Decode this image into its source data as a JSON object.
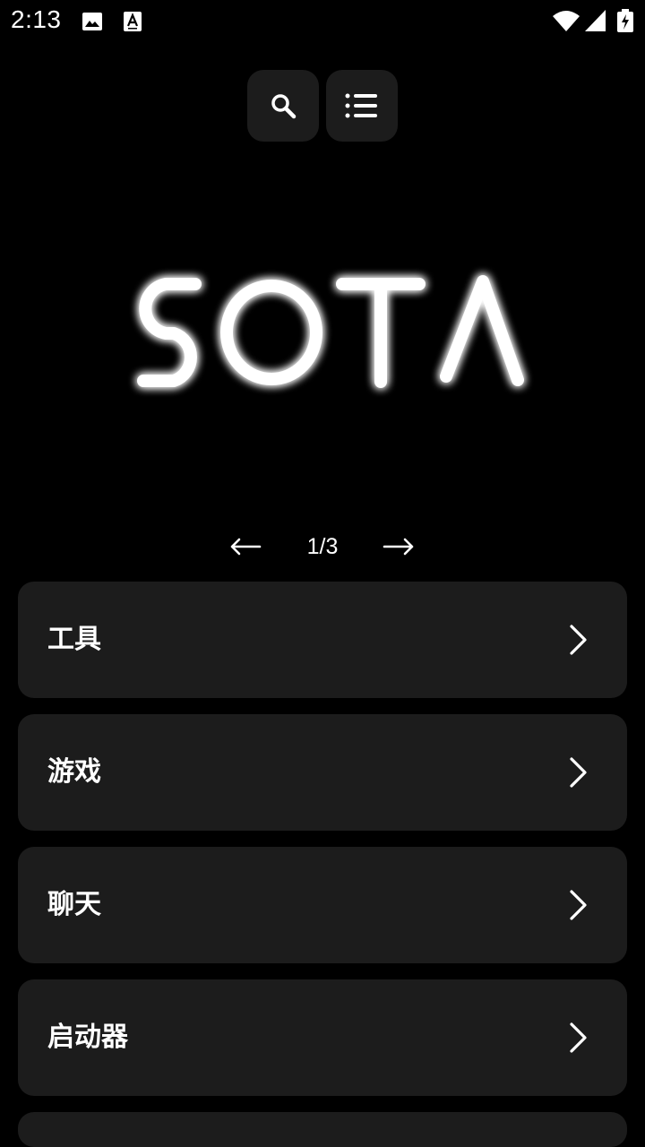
{
  "status_bar": {
    "time": "2:13",
    "left_icons": [
      "image-icon",
      "font-a-icon"
    ],
    "right_icons": [
      "wifi-icon",
      "cellular-signal-icon",
      "battery-charging-icon"
    ]
  },
  "toolbar": {
    "search_icon": "search-icon",
    "menu_icon": "list-menu-icon"
  },
  "logo": {
    "text": "SOTA",
    "glow_color": "#ffffff"
  },
  "pager": {
    "prev_icon": "arrow-left-icon",
    "next_icon": "arrow-right-icon",
    "label": "1/3"
  },
  "categories": [
    {
      "label": "工具"
    },
    {
      "label": "游戏"
    },
    {
      "label": "聊天"
    },
    {
      "label": "启动器"
    }
  ],
  "colors": {
    "background": "#000000",
    "card": "#1c1c1c",
    "text": "#ffffff"
  }
}
